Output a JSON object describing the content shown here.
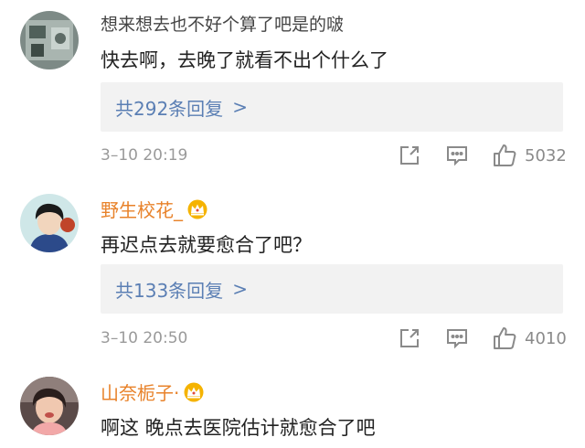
{
  "comments": [
    {
      "username": "",
      "text_top": "想来想去也不好个算了吧是的啵",
      "text": "快去啊，去晚了就看不出个什么了",
      "reply_label": "共292条回复",
      "reply_chevron": ">",
      "time": "3–10 20:19",
      "likes": "5032"
    },
    {
      "username": "野生校花_",
      "text": "再迟点去就要愈合了吧？",
      "reply_label": "共133条回复",
      "reply_chevron": ">",
      "time": "3–10 20:50",
      "likes": "4010"
    },
    {
      "username": "山奈栀子·",
      "text": "啊这 晚点去医院估计就愈合了吧"
    }
  ],
  "colors": {
    "username": "#e8822a",
    "reply_link": "#5b7fb4",
    "meta": "#9a9a9a",
    "reply_bg": "#f2f2f2",
    "crown": "#f5b300"
  },
  "icons": {
    "share": "share-icon",
    "comment": "comment-icon",
    "like": "thumbs-up-icon",
    "crown": "crown-badge-icon"
  }
}
